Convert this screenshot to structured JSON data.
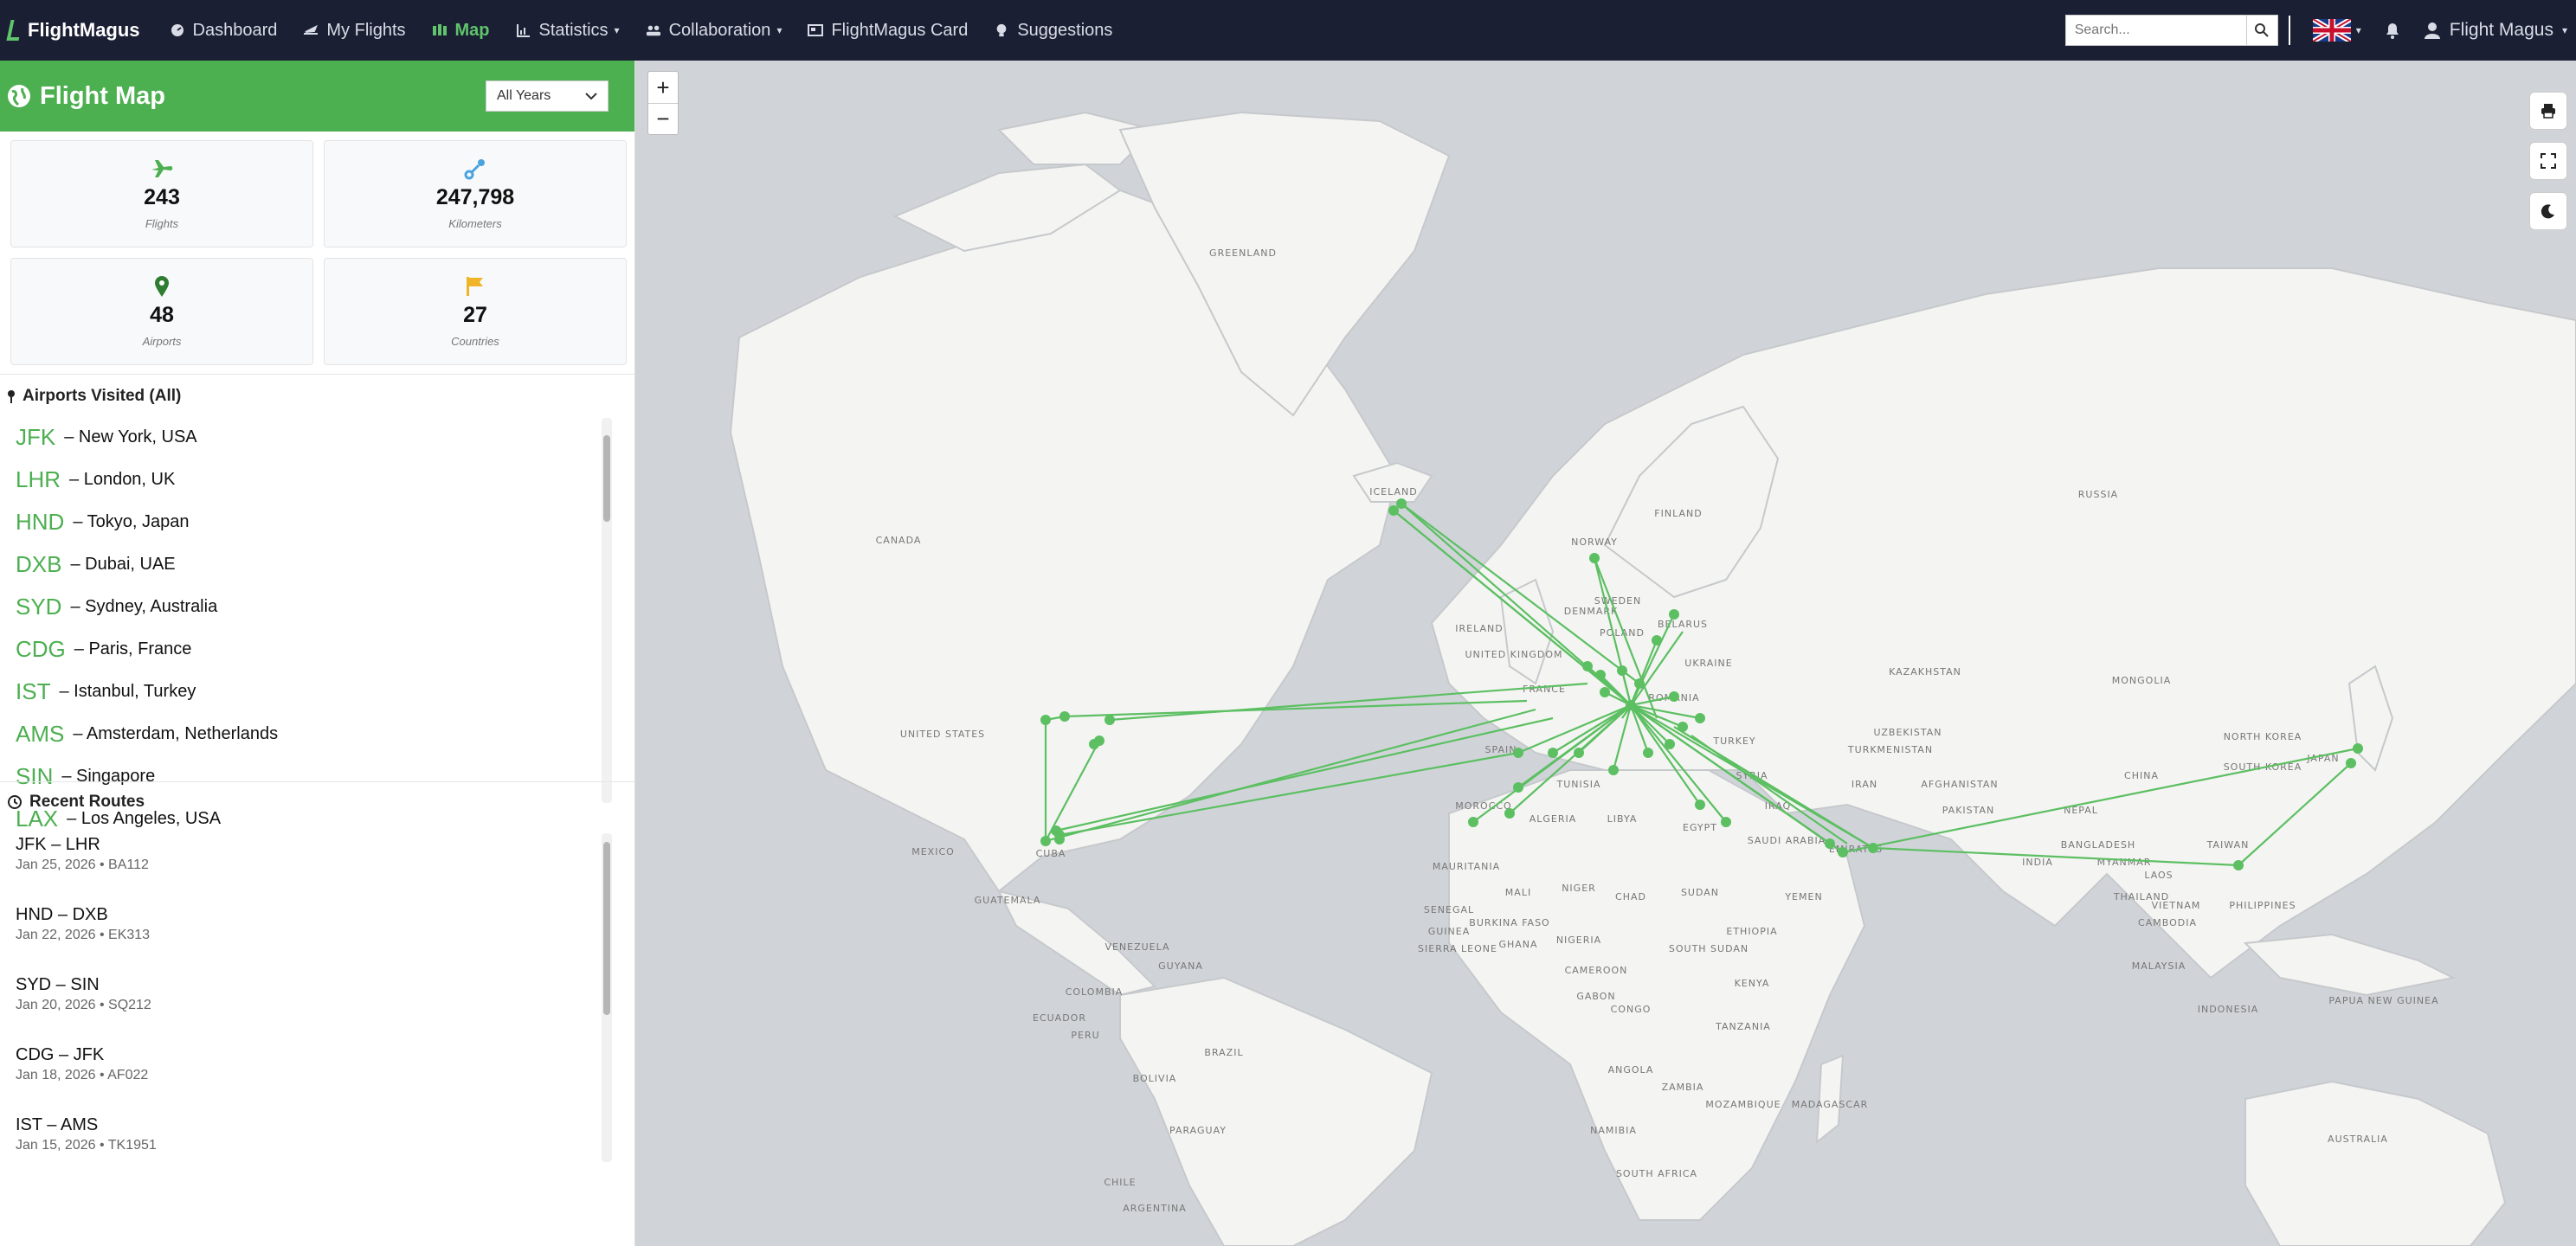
{
  "nav": {
    "brand": "FlightMagus",
    "items": [
      {
        "label": "Dashboard",
        "icon": "dashboard-icon"
      },
      {
        "label": "My Flights",
        "icon": "flights-icon"
      },
      {
        "label": "Map",
        "icon": "map-icon",
        "active": true
      },
      {
        "label": "Statistics",
        "icon": "chart-icon",
        "dropdown": true
      },
      {
        "label": "Collaboration",
        "icon": "people-icon",
        "dropdown": true
      },
      {
        "label": "FlightMagus Card",
        "icon": "card-icon"
      },
      {
        "label": "Suggestions",
        "icon": "lightbulb-icon"
      }
    ],
    "search_placeholder": "Search...",
    "user": "Flight Magus"
  },
  "sidebar": {
    "title": "Flight Map",
    "year_filter": "All Years",
    "stats": [
      {
        "value": "243",
        "label": "Flights",
        "icon": "plane-icon",
        "color": "#4caf50"
      },
      {
        "value": "247,798",
        "label": "Kilometers",
        "icon": "route-icon",
        "color": "#4aa3df"
      },
      {
        "value": "48",
        "label": "Airports",
        "icon": "pin-icon",
        "color": "#2e7d32"
      },
      {
        "value": "27",
        "label": "Countries",
        "icon": "flag-icon",
        "color": "#f0b429"
      }
    ],
    "airports_title": "Airports Visited (All)",
    "airports": [
      {
        "code": "JFK",
        "name": "– New York, USA"
      },
      {
        "code": "LHR",
        "name": "– London, UK"
      },
      {
        "code": "HND",
        "name": "– Tokyo, Japan"
      },
      {
        "code": "DXB",
        "name": "– Dubai, UAE"
      },
      {
        "code": "SYD",
        "name": "– Sydney, Australia"
      },
      {
        "code": "CDG",
        "name": "– Paris, France"
      },
      {
        "code": "IST",
        "name": "– Istanbul, Turkey"
      },
      {
        "code": "AMS",
        "name": "– Amsterdam, Netherlands"
      },
      {
        "code": "SIN",
        "name": "– Singapore"
      },
      {
        "code": "LAX",
        "name": "– Los Angeles, USA"
      }
    ],
    "routes_title": "Recent Routes",
    "routes": [
      {
        "route": "JFK – LHR",
        "meta": "Jan 25, 2026 • BA112"
      },
      {
        "route": "HND – DXB",
        "meta": "Jan 22, 2026 • EK313"
      },
      {
        "route": "SYD – SIN",
        "meta": "Jan 20, 2026 • SQ212"
      },
      {
        "route": "CDG – JFK",
        "meta": "Jan 18, 2026 • AF022"
      },
      {
        "route": "IST – AMS",
        "meta": "Jan 15, 2026 • TK1951"
      }
    ]
  },
  "map": {
    "route_color": "#5cbf62",
    "labels": [
      "GREENLAND",
      "ICELAND",
      "NORWAY",
      "FINLAND",
      "SWEDEN",
      "DENMARK",
      "CANADA",
      "RUSSIA",
      "UNITED STATES",
      "MEXICO",
      "CUBA",
      "GUATEMALA",
      "VENEZUELA",
      "GUYANA",
      "COLOMBIA",
      "ECUADOR",
      "PERU",
      "BRAZIL",
      "BOLIVIA",
      "PARAGUAY",
      "CHILE",
      "ARGENTINA",
      "IRELAND",
      "UNITED KINGDOM",
      "FRANCE",
      "SPAIN",
      "POLAND",
      "BELARUS",
      "UKRAINE",
      "ROMANIA",
      "TURKEY",
      "SYRIA",
      "IRAQ",
      "IRAN",
      "KAZAKHSTAN",
      "UZBEKISTAN",
      "TURKMENISTAN",
      "AFGHANISTAN",
      "PAKISTAN",
      "INDIA",
      "NEPAL",
      "CHINA",
      "MONGOLIA",
      "NORTH KOREA",
      "SOUTH KOREA",
      "JAPAN",
      "TAIWAN",
      "THAILAND",
      "LAOS",
      "VIETNAM",
      "CAMBODIA",
      "MALAYSIA",
      "INDONESIA",
      "PAPUA NEW GUINEA",
      "AUSTRALIA",
      "MOROCCO",
      "ALGERIA",
      "TUNISIA",
      "LIBYA",
      "EGYPT",
      "SAUDI ARABIA",
      "EMIRATES",
      "YEMEN",
      "MAURITANIA",
      "MALI",
      "NIGER",
      "CHAD",
      "SUDAN",
      "SENEGAL",
      "GUINEA",
      "SIERRA LEONE",
      "BURKINA FASO",
      "GHANA",
      "NIGERIA",
      "ETHIOPIA",
      "SOUTH SUDAN",
      "CAMEROON",
      "GABON",
      "CONGO",
      "KENYA",
      "TANZANIA",
      "ANGOLA",
      "ZAMBIA",
      "MOZAMBIQUE",
      "NAMIBIA",
      "SOUTH AFRICA",
      "MADAGASCAR",
      "BANGLADESH",
      "MYANMAR",
      "PHILIPPINES"
    ]
  }
}
